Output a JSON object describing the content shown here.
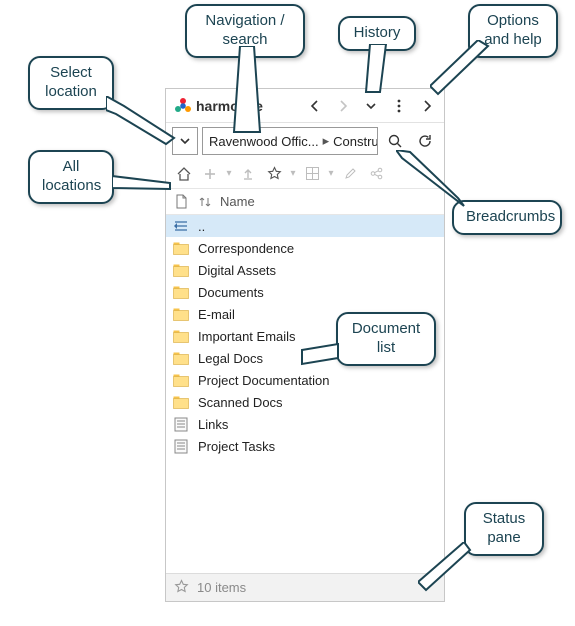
{
  "app": {
    "title": "harmon.ie"
  },
  "history": {
    "back_enabled": true,
    "forward_enabled": false
  },
  "breadcrumb": {
    "segments": [
      {
        "text": "Ravenwood Offic..."
      },
      {
        "text": "Construction"
      }
    ]
  },
  "columns": {
    "name": "Name"
  },
  "list": {
    "up": "..",
    "items": [
      {
        "type": "folder",
        "label": "Correspondence"
      },
      {
        "type": "folder",
        "label": "Digital Assets"
      },
      {
        "type": "folder",
        "label": "Documents"
      },
      {
        "type": "folder",
        "label": "E-mail"
      },
      {
        "type": "folder",
        "label": "Important Emails"
      },
      {
        "type": "folder",
        "label": "Legal Docs"
      },
      {
        "type": "folder",
        "label": "Project Documentation"
      },
      {
        "type": "folder",
        "label": "Scanned Docs"
      },
      {
        "type": "list",
        "label": "Links"
      },
      {
        "type": "list",
        "label": "Project Tasks"
      }
    ]
  },
  "status": {
    "text": "10 items"
  },
  "callouts": {
    "select_location": "Select\nlocation",
    "all_locations": "All\nlocations",
    "nav_search": "Navigation /\nsearch",
    "history": "History",
    "options": "Options\nand help",
    "breadcrumbs": "Breadcrumbs",
    "doc_list": "Document\nlist",
    "status_pane": "Status\npane"
  }
}
